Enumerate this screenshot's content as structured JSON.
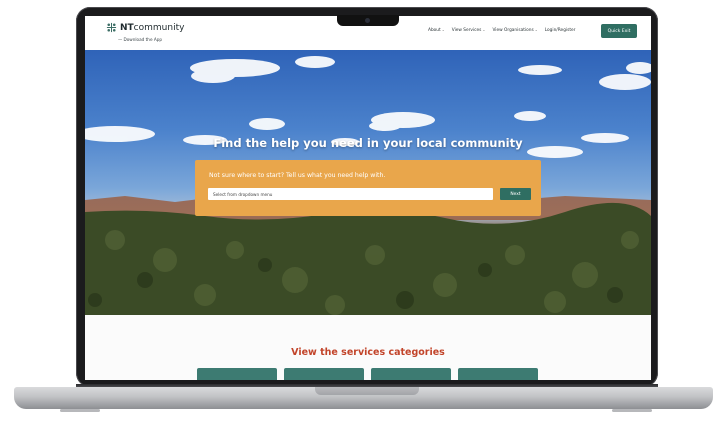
{
  "header": {
    "logo_brand_bold": "NT",
    "logo_brand_rest": "community",
    "download_link": "— Download the App",
    "nav": [
      {
        "label": "About",
        "has_dropdown": true
      },
      {
        "label": "View Services",
        "has_dropdown": true
      },
      {
        "label": "View Organisations",
        "has_dropdown": true
      },
      {
        "label": "Login/Register",
        "has_dropdown": false
      }
    ],
    "quick_exit": "Quick Exit"
  },
  "hero": {
    "title": "Find the help you need in your local community",
    "prompt": "Not sure where to start? Tell us what you need help with.",
    "dropdown_value": "Select from dropdown menu",
    "next_button": "Next"
  },
  "categories": {
    "title": "View the services categories",
    "tile_count": 4
  },
  "colors": {
    "primary_green": "#2f6e62",
    "panel_orange": "#e9a64b",
    "heading_red": "#c2442a"
  },
  "icons": {
    "logo": "nt-community-logo-icon",
    "dropdown": "chevron-down-icon"
  }
}
